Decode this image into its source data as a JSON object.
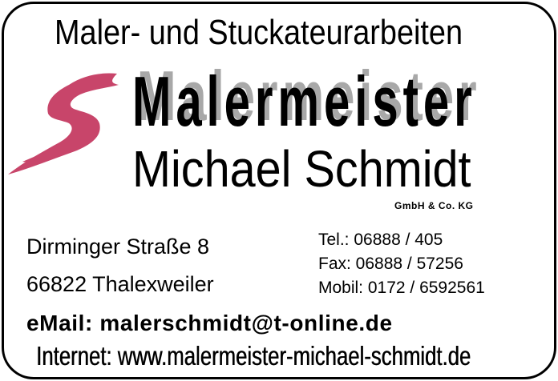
{
  "tagline": "Maler- und Stuckateurarbeiten",
  "logo": {
    "icon": "pink-brush-s-logo",
    "color": "#c8456a",
    "title": "Malermeister"
  },
  "company": {
    "name": "Michael Schmidt",
    "legal_form": "GmbH & Co. KG"
  },
  "address": {
    "street": "Dirminger Straße 8",
    "city": "66822 Thalexweiler"
  },
  "contact": {
    "tel": "Tel.: 06888 / 405",
    "fax": "Fax: 06888 / 57256",
    "mobil": "Mobil: 0172 / 6592561",
    "email": "eMail: malerschmidt@t-online.de",
    "internet": "Internet: www.malermeister-michael-schmidt.de"
  }
}
